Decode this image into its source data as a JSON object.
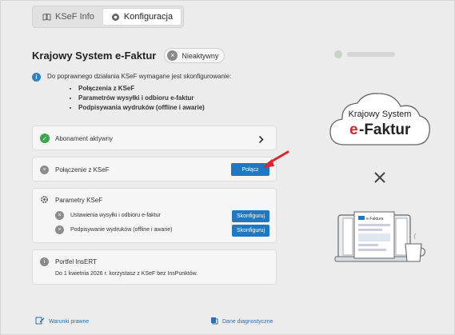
{
  "tabs": [
    {
      "label": "KSeF Info",
      "icon": "book-icon"
    },
    {
      "label": "Konfiguracja",
      "icon": "gear-icon"
    }
  ],
  "header": {
    "title": "Krajowy System e-Faktur",
    "status": "Nieaktywny"
  },
  "info": {
    "text": "Do poprawnego działania KSeF wymagane jest skonfigurowanie:",
    "items": [
      "Połączenia z KSeF",
      "Parametrów wysyłki i odbioru e-faktur",
      "Podpisywania wydruków (offline i awarie)"
    ]
  },
  "subscription": {
    "label": "Abonament aktywny"
  },
  "connection": {
    "label": "Połączenie z KSeF",
    "button": "Połącz"
  },
  "params": {
    "title": "Parametry KSeF",
    "rows": [
      {
        "label": "Ustawienia wysyłki i odbioru e-faktur",
        "button": "Skonfiguruj"
      },
      {
        "label": "Podpisywanie wydruków (offline i awarie)",
        "button": "Skonfiguruj"
      }
    ]
  },
  "portfel": {
    "title": "Portfel InsERT",
    "text": "Do 1 kwietnia 2026 r. korzystasz z KSeF bez InsPunktów."
  },
  "footer": {
    "legal": "Warunki prawne",
    "diagnostics": "Dane diagnostyczne"
  },
  "illustration": {
    "cloud_line1": "Krajowy System",
    "cloud_e": "e",
    "cloud_rest": "-Faktur",
    "doc_label": "e-Faktura",
    "brand_red": "#d0262c",
    "accent_blue": "#1f78c1"
  }
}
